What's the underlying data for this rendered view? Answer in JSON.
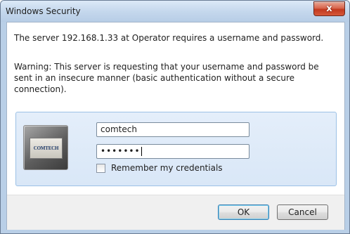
{
  "window": {
    "title": "Windows Security",
    "close_glyph": "x"
  },
  "message": {
    "line1": "The server 192.168.1.33 at Operator requires a username and password.",
    "warning": "Warning: This server is requesting that your username and password be sent in an insecure manner (basic authentication without a secure connection)."
  },
  "credentials": {
    "tile_logo_text": "COMTECH",
    "username_value": "comtech",
    "password_mask": "•••••••",
    "remember_label": "Remember my credentials",
    "remember_checked": false
  },
  "buttons": {
    "ok_label": "OK",
    "cancel_label": "Cancel"
  }
}
